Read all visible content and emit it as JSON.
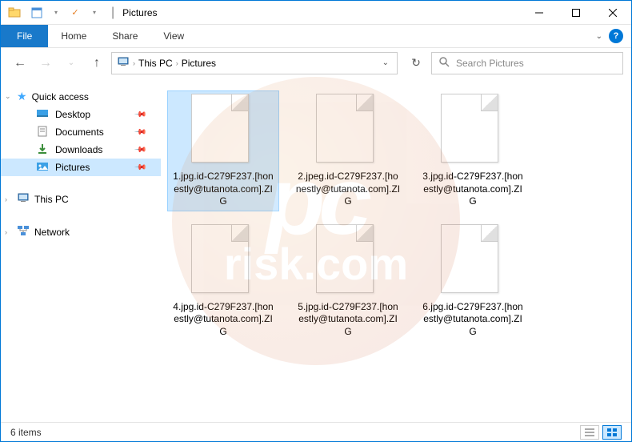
{
  "titlebar": {
    "title": "Pictures"
  },
  "menubar": {
    "file": "File",
    "home": "Home",
    "share": "Share",
    "view": "View"
  },
  "breadcrumb": {
    "items": [
      "This PC",
      "Pictures"
    ]
  },
  "search": {
    "placeholder": "Search Pictures"
  },
  "sidebar": {
    "quick_access": "Quick access",
    "items": [
      {
        "label": "Desktop"
      },
      {
        "label": "Documents"
      },
      {
        "label": "Downloads"
      },
      {
        "label": "Pictures"
      }
    ],
    "this_pc": "This PC",
    "network": "Network"
  },
  "files": [
    {
      "name": "1.jpg.id-C279F237.[honestly@tutanota.com].ZIG",
      "selected": true
    },
    {
      "name": "2.jpeg.id-C279F237.[honestly@tutanota.com].ZIG",
      "selected": false
    },
    {
      "name": "3.jpg.id-C279F237.[honestly@tutanota.com].ZIG",
      "selected": false
    },
    {
      "name": "4.jpg.id-C279F237.[honestly@tutanota.com].ZIG",
      "selected": false
    },
    {
      "name": "5.jpg.id-C279F237.[honestly@tutanota.com].ZIG",
      "selected": false
    },
    {
      "name": "6.jpg.id-C279F237.[honestly@tutanota.com].ZIG",
      "selected": false
    }
  ],
  "statusbar": {
    "count": "6 items"
  },
  "watermark": {
    "line1": "pc",
    "line2": "risk.com"
  }
}
